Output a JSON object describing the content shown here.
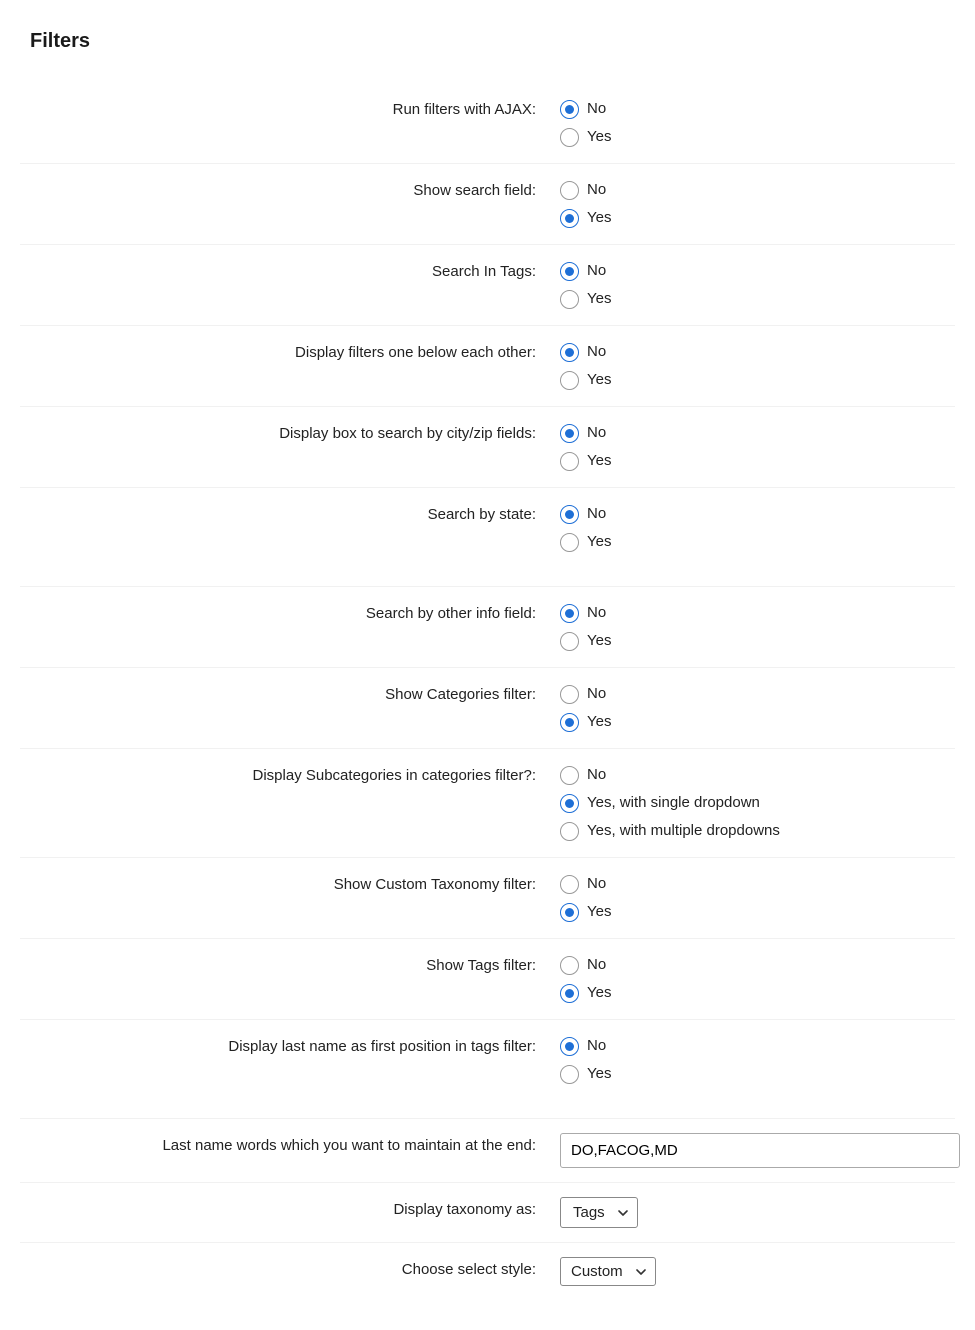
{
  "section_title": "Filters",
  "labels": {
    "no": "No",
    "yes": "Yes",
    "single": "Yes, with single dropdown",
    "multiple": "Yes, with multiple dropdowns"
  },
  "fields": {
    "ajax": {
      "label": "Run filters with AJAX:",
      "value": "no"
    },
    "show_search": {
      "label": "Show search field:",
      "value": "yes"
    },
    "search_tags": {
      "label": "Search In Tags:",
      "value": "no"
    },
    "one_below": {
      "label": "Display filters one below each other:",
      "value": "no"
    },
    "search_city_zip": {
      "label": "Display box to search by city/zip fields:",
      "value": "no"
    },
    "search_state": {
      "label": "Search by state:",
      "value": "no"
    },
    "search_other_info": {
      "label": "Search by other info field:",
      "value": "no"
    },
    "show_categories": {
      "label": "Show Categories filter:",
      "value": "yes"
    },
    "subcategories": {
      "label": "Display Subcategories in categories filter?:",
      "value": "single"
    },
    "custom_taxonomy": {
      "label": "Show Custom Taxonomy filter:",
      "value": "yes"
    },
    "show_tags_filter": {
      "label": "Show Tags filter:",
      "value": "yes"
    },
    "lastname_first": {
      "label": "Display last name as first position in tags filter:",
      "value": "no"
    },
    "lastname_words": {
      "label": "Last name words which you want to maintain at the end:",
      "value": "DO,FACOG,MD"
    },
    "display_taxonomy_as": {
      "label": "Display taxonomy as:",
      "value": "Tags"
    },
    "select_style": {
      "label": "Choose select style:",
      "value": "Custom"
    }
  }
}
